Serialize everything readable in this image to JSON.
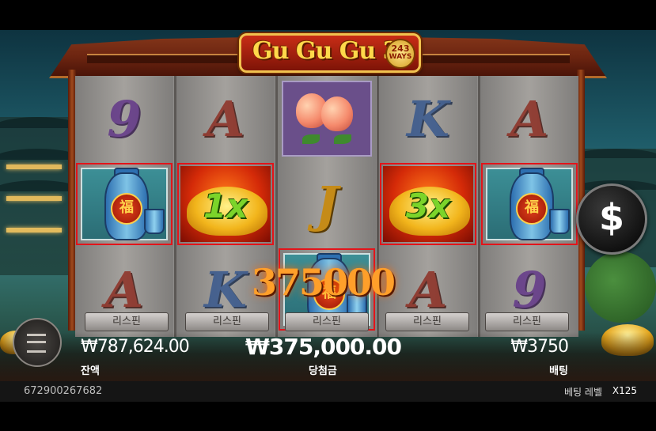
{
  "game": {
    "logo": "Gu Gu Gu 3",
    "ways_number": "243",
    "ways_label": "WAYS"
  },
  "reels": [
    [
      "9",
      "vase",
      "A"
    ],
    [
      "A",
      "1x",
      "K"
    ],
    [
      "peach",
      "J",
      "vase"
    ],
    [
      "K",
      "3x",
      "A"
    ],
    [
      "A",
      "vase",
      "9"
    ]
  ],
  "winning_cells": [
    [
      0,
      1
    ],
    [
      1,
      1
    ],
    [
      2,
      2
    ],
    [
      3,
      1
    ],
    [
      4,
      1
    ]
  ],
  "respin_buttons": [
    "리스핀",
    "리스핀",
    "리스핀",
    "리스핀",
    "리스핀"
  ],
  "big_win_text": "375000",
  "coin_button_symbol": "$",
  "status": {
    "balance_value": "₩787,624.00",
    "balance_label": "잔액",
    "win_value": "₩375,000.00",
    "win_label": "당첨금",
    "bet_value": "₩3750",
    "bet_label": "배팅"
  },
  "footer": {
    "round_id": "672900267682",
    "bet_level_label": "베팅 레벨",
    "bet_level_value": "X125"
  },
  "colors": {
    "win_border": "#e3141a",
    "frame_red": "#8a3a1c",
    "multiplier_green": "#7bd42a"
  }
}
